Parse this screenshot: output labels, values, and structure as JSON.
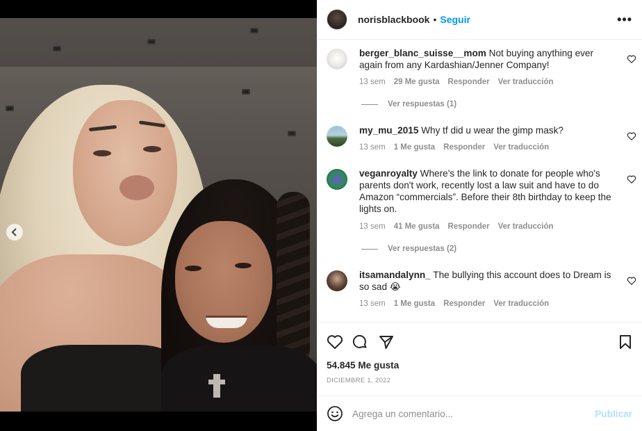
{
  "post": {
    "author": "norisblackbook",
    "separator": "•",
    "follow_label": "Seguir",
    "more_label": "•••"
  },
  "comments": [
    {
      "user": "berger_blanc_suisse__mom",
      "text": "Not buying anything ever again from any Kardashian/Jenner Company!",
      "time": "13 sem",
      "likes": "29 Me gusta",
      "reply_label": "Responder",
      "translate_label": "Ver traducción",
      "view_replies": "Ver respuestas (1)"
    },
    {
      "user": "my_mu_2015",
      "text": "Why tf did u wear the gimp mask?",
      "time": "13 sem",
      "likes": "1 Me gusta",
      "reply_label": "Responder",
      "translate_label": "Ver traducción"
    },
    {
      "user": "veganroyalty",
      "text": "Where's the link to donate for people who's parents don't work, recently lost a law suit and have to do Amazon “commercials”. Before their 8th birthday to keep the lights on.",
      "time": "13 sem",
      "likes": "41 Me gusta",
      "reply_label": "Responder",
      "translate_label": "Ver traducción",
      "view_replies": "Ver respuestas (2)"
    },
    {
      "user": "itsamandalynn_",
      "text": "The bullying this account does to Dream is so sad 😭",
      "time": "13 sem",
      "likes": "1 Me gusta",
      "reply_label": "Responder",
      "translate_label": "Ver traducción"
    }
  ],
  "stats": {
    "likes": "54.845 Me gusta",
    "date": "DICIEMBRE 1, 2022"
  },
  "composer": {
    "placeholder": "Agrega un comentario...",
    "post_label": "Publicar"
  },
  "carousel": {
    "current_slide": 2,
    "total_slides": 2
  },
  "colors": {
    "accent": "#0095f6",
    "post_disabled": "#b2dffc",
    "secondary_text": "#8e8e8e",
    "primary_text": "#262626"
  },
  "icons": {
    "prev": "chevron-left-icon",
    "like": "heart-icon",
    "comment": "comment-bubble-icon",
    "share": "paper-plane-icon",
    "save": "bookmark-icon",
    "emoji": "smiley-icon",
    "more": "more-options-icon"
  }
}
